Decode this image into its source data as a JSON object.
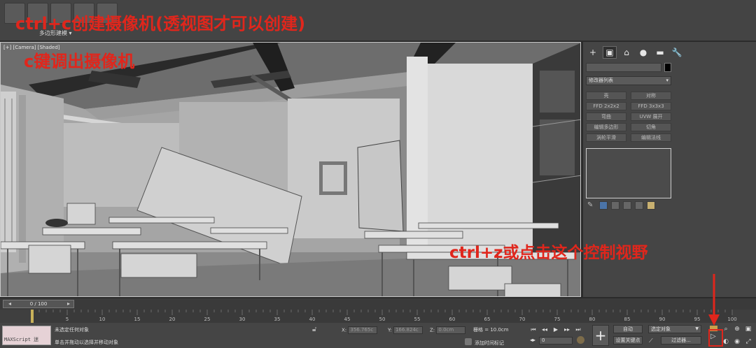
{
  "annotations": {
    "line1": "ctrl+c创建摄像机(透视图才可以创建)",
    "line2": "c键调出摄像机",
    "line3": "ctrl+z或点击这个控制视野"
  },
  "toolbar": {
    "ribbon_tab": "多边形建模 ▾"
  },
  "viewport": {
    "label": "[+] [Camera] [Shaded]"
  },
  "command_panel": {
    "tabs": [
      "+",
      "▣",
      "⌂",
      "●",
      "▬",
      "🔧"
    ],
    "modifier_list": "修改器列表",
    "modifiers": [
      "壳",
      "对称",
      "FFD 2x2x2",
      "FFD 3x3x3",
      "弯曲",
      "UVW 展开",
      "编辑多边形",
      "切角",
      "涡轮平滑",
      "编辑法线"
    ]
  },
  "timeline": {
    "frame_display": "0 / 100",
    "ticks": [
      "0",
      "5",
      "10",
      "15",
      "20",
      "25",
      "30",
      "35",
      "40",
      "45",
      "50",
      "55",
      "60",
      "65",
      "70",
      "75",
      "80",
      "85",
      "90",
      "95",
      "100"
    ]
  },
  "status": {
    "maxscript": "MAXScript 迷",
    "line1": "未选定任何对象",
    "line2": "单击并拖动以选择并移动对象",
    "x_label": "X:",
    "x_value": "356.765c",
    "y_label": "Y:",
    "y_value": "166.824c",
    "z_label": "Z:",
    "z_value": "0.0cm",
    "grid": "栅格 = 10.0cm",
    "add_time_tag": "添加时间标记",
    "current_frame": "0",
    "auto_key": "自动",
    "selected_object": "选定对象",
    "set_key": "设置关键点",
    "key_filters": "过滤器..."
  },
  "colors": {
    "annotation_red": "#e0261c",
    "viewport_bg": "#8d8d8d",
    "panel_bg": "#454545"
  }
}
